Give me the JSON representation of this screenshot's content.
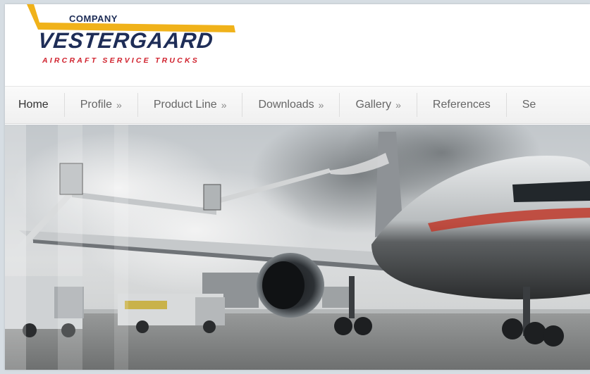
{
  "logo": {
    "company": "COMPANY",
    "name": "VESTERGAARD",
    "tagline": "AIRCRAFT SERVICE TRUCKS",
    "colors": {
      "navy": "#1e2d57",
      "gold": "#f0b21a",
      "red": "#d0202c"
    }
  },
  "nav": {
    "items": [
      {
        "label": "Home",
        "arrow": ""
      },
      {
        "label": "Profile",
        "arrow": "»"
      },
      {
        "label": "Product Line",
        "arrow": "»"
      },
      {
        "label": "Downloads",
        "arrow": "»"
      },
      {
        "label": "Gallery",
        "arrow": "»"
      },
      {
        "label": "References",
        "arrow": ""
      },
      {
        "label": "Se",
        "arrow": ""
      }
    ]
  },
  "hero": {
    "icon": "deicing-aircraft-photo"
  }
}
